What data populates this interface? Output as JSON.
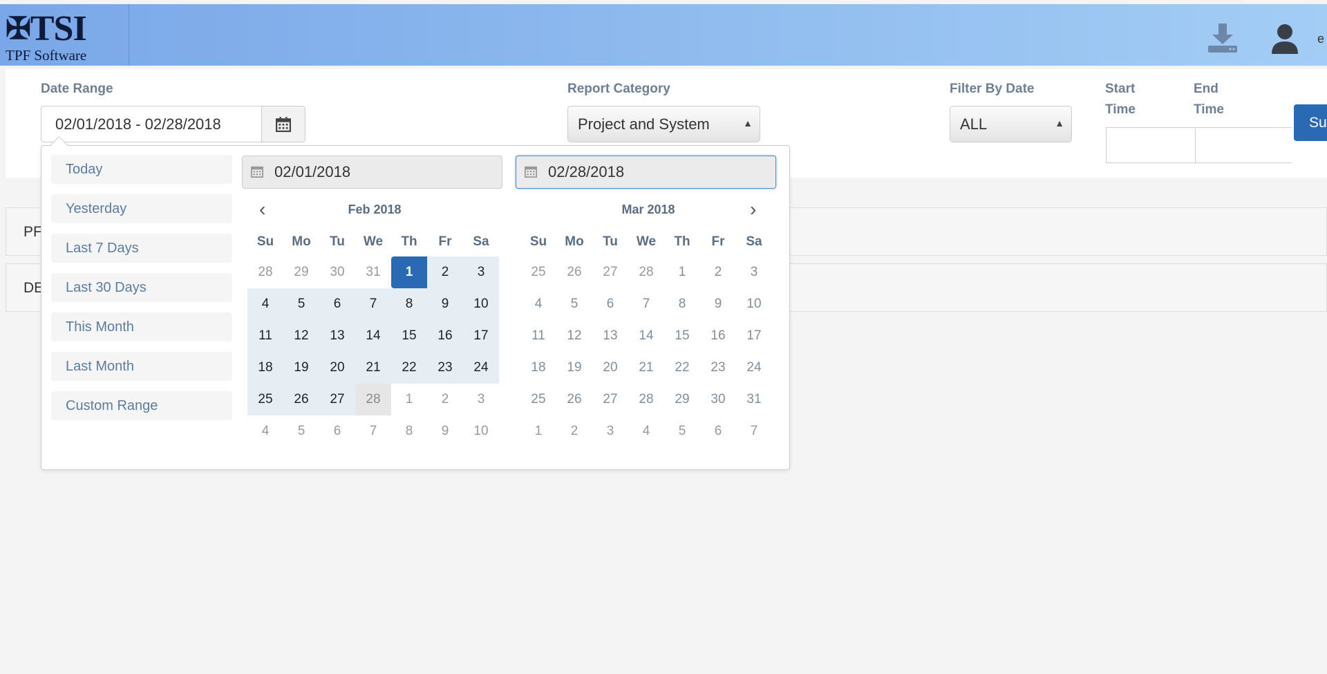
{
  "header": {
    "logo_main": "TSI",
    "logo_sub": "TPF Software",
    "user_label": "e"
  },
  "filters": {
    "date_range_label": "Date Range",
    "date_range_value": "02/01/2018 - 02/28/2018",
    "report_category_label": "Report Category",
    "report_category_value": "Project and System",
    "filter_by_date_label": "Filter By Date",
    "filter_by_date_value": "ALL",
    "start_time_label_1": "Start",
    "start_time_label_2": "Time",
    "end_time_label_1": "End",
    "end_time_label_2": "Time",
    "submit_label": "Su"
  },
  "sections": [
    {
      "label": "PF"
    },
    {
      "label": "DE"
    }
  ],
  "picker": {
    "ranges": [
      "Today",
      "Yesterday",
      "Last 7 Days",
      "Last 30 Days",
      "This Month",
      "Last Month",
      "Custom Range"
    ],
    "start_input": "02/01/2018",
    "end_input": "02/28/2018",
    "left_title": "Feb 2018",
    "right_title": "Mar 2018",
    "weekdays": [
      "Su",
      "Mo",
      "Tu",
      "We",
      "Th",
      "Fr",
      "Sa"
    ],
    "left_weeks": [
      [
        "28",
        "29",
        "30",
        "31",
        "1",
        "2",
        "3"
      ],
      [
        "4",
        "5",
        "6",
        "7",
        "8",
        "9",
        "10"
      ],
      [
        "11",
        "12",
        "13",
        "14",
        "15",
        "16",
        "17"
      ],
      [
        "18",
        "19",
        "20",
        "21",
        "22",
        "23",
        "24"
      ],
      [
        "25",
        "26",
        "27",
        "28",
        "1",
        "2",
        "3"
      ],
      [
        "4",
        "5",
        "6",
        "7",
        "8",
        "9",
        "10"
      ]
    ],
    "right_weeks": [
      [
        "25",
        "26",
        "27",
        "28",
        "1",
        "2",
        "3"
      ],
      [
        "4",
        "5",
        "6",
        "7",
        "8",
        "9",
        "10"
      ],
      [
        "11",
        "12",
        "13",
        "14",
        "15",
        "16",
        "17"
      ],
      [
        "18",
        "19",
        "20",
        "21",
        "22",
        "23",
        "24"
      ],
      [
        "25",
        "26",
        "27",
        "28",
        "29",
        "30",
        "31"
      ],
      [
        "1",
        "2",
        "3",
        "4",
        "5",
        "6",
        "7"
      ]
    ]
  },
  "colors": {
    "header_gradient_start": "#7aa7e8",
    "header_gradient_end": "#a3cdf5",
    "accent": "#2a6ab5",
    "range_highlight": "#e6eef3"
  },
  "icons": [
    "download-icon",
    "user-icon",
    "calendar-icon",
    "chevron-left-icon",
    "chevron-right-icon",
    "select-arrows-icon"
  ]
}
